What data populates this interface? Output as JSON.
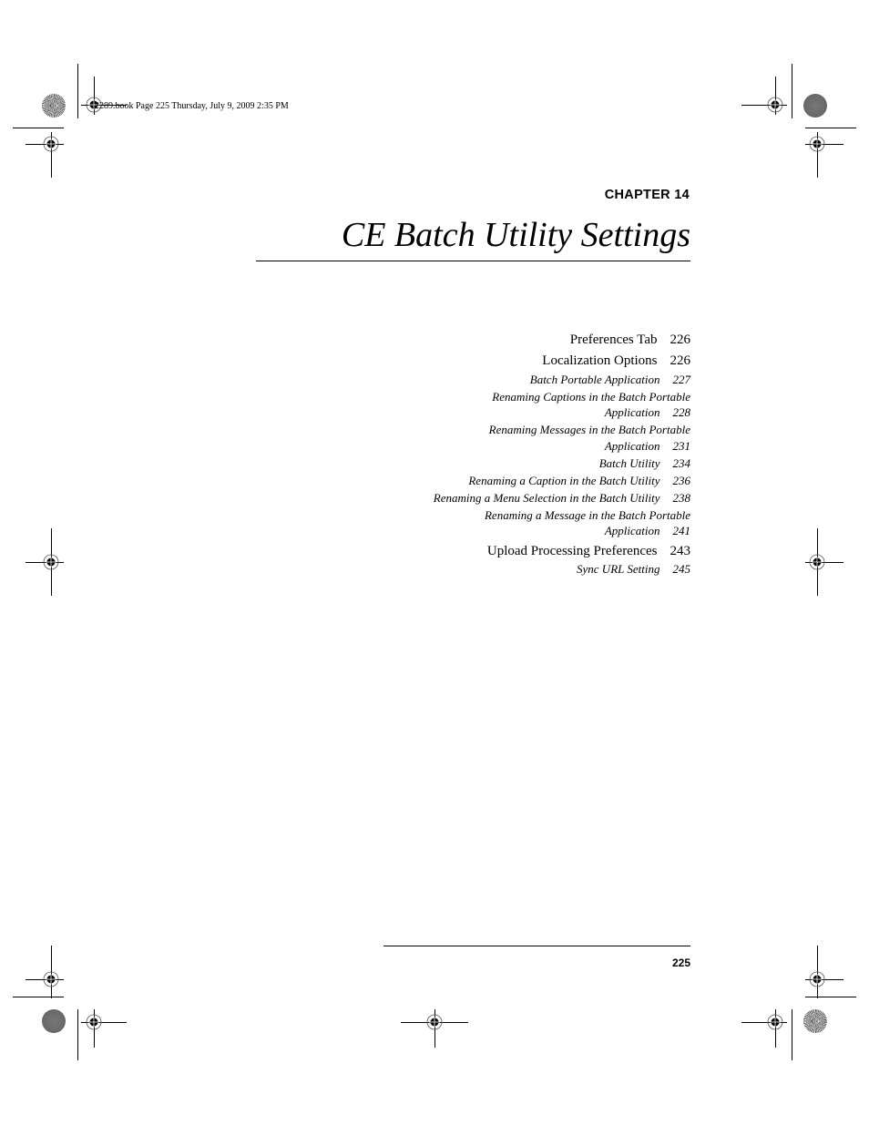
{
  "slug_line": "2289.book  Page 225  Thursday, July 9, 2009  2:35 PM",
  "chapter": {
    "label": "CHAPTER 14",
    "title": "CE Batch Utility Settings"
  },
  "toc": [
    {
      "level": 1,
      "lines": [
        "Preferences Tab"
      ],
      "page": "226"
    },
    {
      "level": 1,
      "lines": [
        "Localization Options"
      ],
      "page": "226"
    },
    {
      "level": 2,
      "lines": [
        "Batch Portable Application"
      ],
      "page": "227"
    },
    {
      "level": 2,
      "lines": [
        "Renaming Captions in the Batch Portable",
        "Application"
      ],
      "page": "228"
    },
    {
      "level": 2,
      "lines": [
        "Renaming Messages in the Batch Portable",
        "Application"
      ],
      "page": "231"
    },
    {
      "level": 2,
      "lines": [
        "Batch Utility"
      ],
      "page": "234"
    },
    {
      "level": 2,
      "lines": [
        "Renaming a Caption in the Batch Utility"
      ],
      "page": "236"
    },
    {
      "level": 2,
      "lines": [
        "Renaming a Menu Selection in the Batch Utility"
      ],
      "page": "238"
    },
    {
      "level": 2,
      "lines": [
        "Renaming a Message in the Batch Portable",
        "Application"
      ],
      "page": "241"
    },
    {
      "level": 1,
      "lines": [
        "Upload Processing Preferences"
      ],
      "page": "243"
    },
    {
      "level": 2,
      "lines": [
        "Sync URL Setting"
      ],
      "page": "245"
    }
  ],
  "footer": {
    "page_number": "225"
  },
  "marks": {
    "registration_icon": "registration-mark-icon",
    "color_bar_icon": "color-target-disc-icon"
  }
}
